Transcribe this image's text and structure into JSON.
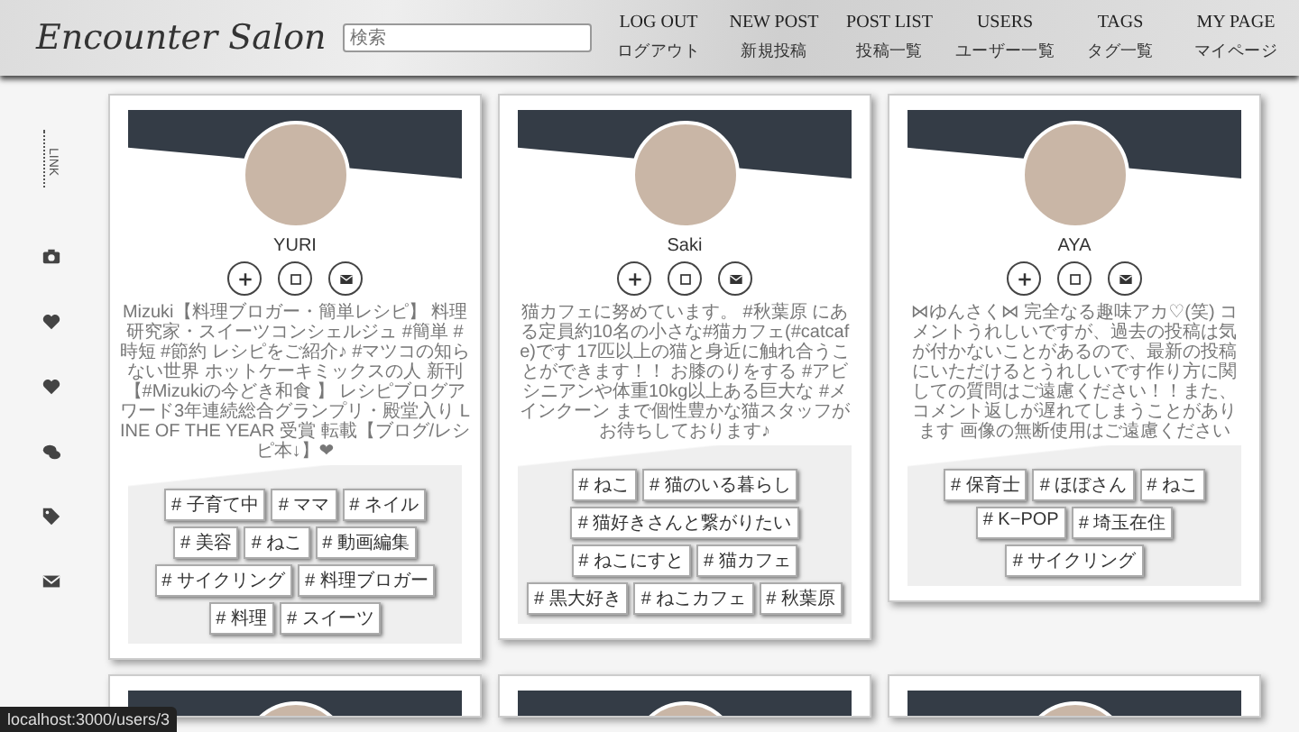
{
  "header": {
    "logo": "Encounter Salon",
    "search": {
      "placeholder": "検索"
    },
    "nav": [
      {
        "label": "LOG OUT",
        "sublabel": "ログアウト"
      },
      {
        "label": "NEW POST",
        "sublabel": "新規投稿"
      },
      {
        "label": "POST LIST",
        "sublabel": "投稿一覧"
      },
      {
        "label": "USERS",
        "sublabel": "ユーザー一覧"
      },
      {
        "label": "TAGS",
        "sublabel": "タグ一覧"
      },
      {
        "label": "MY PAGE",
        "sublabel": "マイページ"
      }
    ]
  },
  "sidebar": {
    "heading": "LINK"
  },
  "cards": [
    {
      "name": "YURI",
      "bio": "Mizuki【料理ブロガー・簡単レシピ】 料理研究家・スイーツコンシェルジュ #簡単 #時短 #節約 レシピをご紹介♪ #マツコの知らない世界 ホットケーキミックスの人 新刊【#Mizukiの今どき和食 】 レシピブログアワード3年連続総合グランプリ・殿堂入り LINE OF THE YEAR 受賞 転載【ブログ/レシピ本↓】❤",
      "tags": [
        "# 子育て中",
        "# ママ",
        "# ネイル",
        "# 美容",
        "# ねこ",
        "# 動画編集",
        "# サイクリング",
        "# 料理ブロガー",
        "# 料理",
        "# スイーツ"
      ]
    },
    {
      "name": "Saki",
      "bio": "猫カフェに努めています。 #秋葉原 にある定員約10名の小さな#猫カフェ(#catcafe)です 17匹以上の猫と身近に触れ合うことができます！！ お膝のりをする #アビシニアンや体重10kg以上ある巨大な #メインクーン まで個性豊かな猫スタッフがお待ちしております♪",
      "tags": [
        "# ねこ",
        "# 猫のいる暮らし",
        "# 猫好きさんと繋がりたい",
        "# ねこにすと",
        "# 猫カフェ",
        "# 黒大好き",
        "# ねこカフェ",
        "# 秋葉原"
      ]
    },
    {
      "name": "AYA",
      "bio": "⋈ゆんさく⋈ 完全なる趣味アカ♡(笑) コメントうれしいですが、過去の投稿は気が付かないことがあるので、最新の投稿にいただけるとうれしいです作り方に関しての質問はご遠慮ください！！また、コメント返しが遅れてしまうことがあります 画像の無断使用はご遠慮ください",
      "tags": [
        "# 保育士",
        "# ほぼさん",
        "# ねこ",
        "# K−POP",
        "# 埼玉在住",
        "# サイクリング"
      ]
    }
  ],
  "status_bar": "localhost:3000/users/3"
}
